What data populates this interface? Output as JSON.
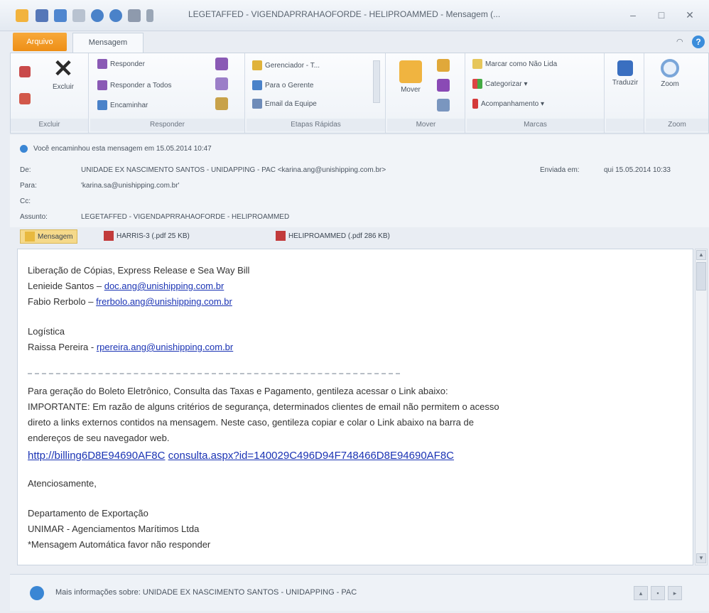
{
  "window": {
    "title": "LEGETAFFED - VIGENDAPRRAHAOFORDE - HELIPROAMMED - Mensagem (...",
    "minimize": "–",
    "maximize": "□",
    "close": "✕"
  },
  "tabs": {
    "file": "Arquivo",
    "message": "Mensagem",
    "minimize_ribbon": "◠",
    "help": "?"
  },
  "ribbon": {
    "groups": {
      "delete": {
        "label": "Excluir",
        "delete_btn": "Excluir"
      },
      "respond": {
        "label": "Responder",
        "reply": "Responder",
        "reply_all": "Responder a Todos",
        "forward": "Encaminhar"
      },
      "quick_steps": {
        "label": "Etapas Rápidas",
        "item1": "Gerenciador - T...",
        "item2": "Para o Gerente",
        "item3": "Email da Equipe"
      },
      "move": {
        "label": "Mover",
        "move_btn": "Mover"
      },
      "tags": {
        "label": "Marcas",
        "unread": "Marcar como Não Lida",
        "categorize": "Categorizar ▾",
        "followup": "Acompanhamento ▾"
      },
      "translate": {
        "label": "",
        "translate_btn": "Traduzir"
      },
      "zoom": {
        "label": "Zoom",
        "zoom_btn": "Zoom"
      }
    }
  },
  "header": {
    "info": "Você encaminhou esta mensagem em 15.05.2014 10:47",
    "from_label": "De:",
    "from_value": "UNIDADE EX NASCIMENTO SANTOS - UNIDAPPING - PAC <karina.ang@unishipping.com.br>",
    "sent_label": "Enviada em:",
    "sent_value": "qui 15.05.2014 10:33",
    "to_label": "Para:",
    "to_value": "'karina.sa@unishipping.com.br'",
    "cc_label": "Cc:",
    "cc_value": "",
    "subject_label": "Assunto:",
    "subject_value": "LEGETAFFED - VIGENDAPRRAHAOFORDE - HELIPROAMMED"
  },
  "attachments": {
    "message_tab": "Mensagem",
    "file1": "HARRIS-3 (.pdf 25 KB)",
    "file2": "HELIPROAMMED (.pdf 286 KB)"
  },
  "body": {
    "line1": "Liberação de Cópias, Express Release e Sea Way Bill",
    "line2_prefix": "Lenieide Santos –",
    "line2_link": "doc.ang@unishipping.com.br",
    "line3_prefix": "Fabio Rerbolo –",
    "line3_link": "frerbolo.ang@unishipping.com.br",
    "line4": "Logística",
    "line5_prefix": "Raissa Pereira -",
    "line5_link": "rpereira.ang@unishipping.com.br",
    "separator": "==================================================",
    "para1": "Para geração do Boleto Eletrônico, Consulta das Taxas e Pagamento, gentileza acessar o Link abaixo:",
    "para2": "IMPORTANTE: Em razão de alguns critérios de segurança, determinados clientes de email não permitem o acesso",
    "para3": "direto a links externos contidos na mensagem. Neste caso, gentileza copiar e colar o Link abaixo na barra de",
    "para4": "endereços de seu navegador web.",
    "link_part1": "http://billing6D8E94690AF8C",
    "link_part2": "consulta.aspx?id=140029C496D94F748466D8E94690AF8C",
    "regards": "Atenciosamente,",
    "sig1": "Departamento de Exportação",
    "sig2": "UNIMAR - Agenciamentos Marítimos Ltda",
    "sig3": "*Mensagem Automática favor não responder"
  },
  "people_pane": {
    "text": "Mais informações sobre: UNIDADE EX NASCIMENTO SANTOS - UNIDAPPING - PAC"
  },
  "colors": {
    "accent": "#ee8f16",
    "link": "#1a33b4",
    "info_icon": "#3a86d4"
  }
}
